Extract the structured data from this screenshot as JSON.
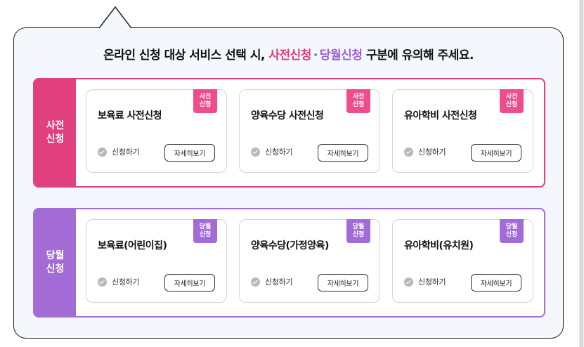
{
  "headline": {
    "part1": "온라인 신청 대상 서비스 선택 시, ",
    "pre_word": "사전신청",
    "dot": "·",
    "same_word": "당월신청",
    "part2": " 구분에 유의해 주세요."
  },
  "groups": [
    {
      "label_line1": "사전",
      "label_line2": "신청",
      "color": "#e0407e",
      "cards": [
        {
          "title": "보육료 사전신청",
          "badge_line1": "사전",
          "badge_line2": "신청",
          "apply_label": "신청하기",
          "detail_label": "자세히보기"
        },
        {
          "title": "양육수당 사전신청",
          "badge_line1": "사전",
          "badge_line2": "신청",
          "apply_label": "신청하기",
          "detail_label": "자세히보기"
        },
        {
          "title": "유아학비 사전신청",
          "badge_line1": "사전",
          "badge_line2": "신청",
          "apply_label": "신청하기",
          "detail_label": "자세히보기"
        }
      ]
    },
    {
      "label_line1": "당월",
      "label_line2": "신청",
      "color": "#a26bd6",
      "cards": [
        {
          "title": "보육료(어린이집)",
          "badge_line1": "당월",
          "badge_line2": "신청",
          "apply_label": "신청하기",
          "detail_label": "자세히보기"
        },
        {
          "title": "양육수당(가정양육)",
          "badge_line1": "당월",
          "badge_line2": "신청",
          "apply_label": "신청하기",
          "detail_label": "자세히보기"
        },
        {
          "title": "유아학비(유치원)",
          "badge_line1": "당월",
          "badge_line2": "신청",
          "apply_label": "신청하기",
          "detail_label": "자세히보기"
        }
      ]
    }
  ],
  "icons": {
    "apply": "check-circle-icon"
  }
}
